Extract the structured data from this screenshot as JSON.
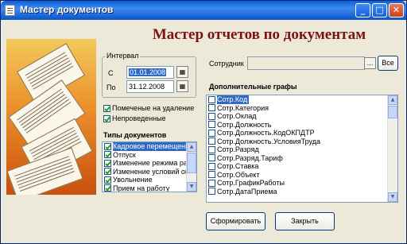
{
  "window": {
    "title": "Мастер документов",
    "min_label": "_",
    "max_label": "□",
    "close_label": "✕"
  },
  "heading": "Мастер отчетов по документам",
  "interval": {
    "group_label": "Интервал",
    "from_label": "С",
    "from_value": "01.01.2008",
    "to_label": "По",
    "to_value": "31.12.2008"
  },
  "checkboxes": [
    {
      "label": "Помеченые на удаление",
      "checked": true
    },
    {
      "label": "Непроведенные",
      "checked": true
    }
  ],
  "doc_types": {
    "label": "Типы документов",
    "items": [
      {
        "label": "Кадровое перемещени",
        "checked": true,
        "selected": true
      },
      {
        "label": "Отпуск",
        "checked": true,
        "selected": false
      },
      {
        "label": "Изменение режима ра",
        "checked": true,
        "selected": false
      },
      {
        "label": "Изменение условий оп",
        "checked": true,
        "selected": false
      },
      {
        "label": "Увольнение",
        "checked": true,
        "selected": false
      },
      {
        "label": "Прием на работу",
        "checked": true,
        "selected": false
      }
    ]
  },
  "employee": {
    "label": "Сотрудник",
    "value": "",
    "browse_label": "...",
    "all_label": "Все"
  },
  "extra": {
    "label": "Дополнительные графы",
    "items": [
      {
        "label": "Сотр.Код",
        "selected": true
      },
      {
        "label": "Сотр.Категория",
        "selected": false
      },
      {
        "label": "Сотр.Оклад",
        "selected": false
      },
      {
        "label": "Сотр.Должность",
        "selected": false
      },
      {
        "label": "Сотр.Должность.КодОКПДТР",
        "selected": false
      },
      {
        "label": "Сотр.Должность.УсловияТруда",
        "selected": false
      },
      {
        "label": "Сотр.Разряд",
        "selected": false
      },
      {
        "label": "Сотр.Разряд.Тариф",
        "selected": false
      },
      {
        "label": "Сотр.Ставка",
        "selected": false
      },
      {
        "label": "Сотр.Объект",
        "selected": false
      },
      {
        "label": "Сотр.ГрафикРаботы",
        "selected": false
      },
      {
        "label": "Сотр.ДатаПриема",
        "selected": false
      }
    ]
  },
  "buttons": {
    "generate": "Сформировать",
    "close": "Закрыть"
  }
}
